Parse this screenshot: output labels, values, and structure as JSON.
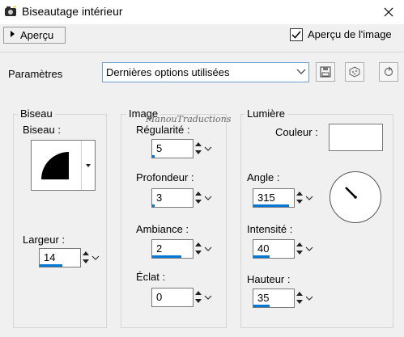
{
  "window": {
    "title": "Biseautage intérieur",
    "close_icon": "close-icon"
  },
  "preview": {
    "toggle_label": "Aperçu",
    "checkbox_label": "Aperçu de l'image",
    "checked": true
  },
  "presets": {
    "label": "Paramètres",
    "selected": "Dernières options utilisées"
  },
  "watermark": "ManouTraductions",
  "bevel": {
    "group_label": "Biseau",
    "bevel_label": "Biseau :",
    "width_label": "Largeur :",
    "width_value": "14",
    "width_fill": 0.55
  },
  "image": {
    "group_label": "Image",
    "smoothness": {
      "label": "Régularité :",
      "value": "5",
      "fill": 0.05
    },
    "depth": {
      "label": "Profondeur :",
      "value": "3",
      "fill": 0.05
    },
    "ambience": {
      "label": "Ambiance :",
      "value": "2",
      "fill": 0.72
    },
    "shininess": {
      "label": "Éclat :",
      "value": "0",
      "fill": 0.0
    }
  },
  "light": {
    "group_label": "Lumière",
    "color_label": "Couleur :",
    "color_value": "#ffffff",
    "angle": {
      "label": "Angle :",
      "value": "315",
      "fill": 0.88
    },
    "intensity": {
      "label": "Intensité :",
      "value": "40",
      "fill": 0.4
    },
    "elevation": {
      "label": "Hauteur :",
      "value": "35",
      "fill": 0.39
    }
  },
  "colors": {
    "accent": "#0078d7",
    "background": "#f0f0f0"
  }
}
